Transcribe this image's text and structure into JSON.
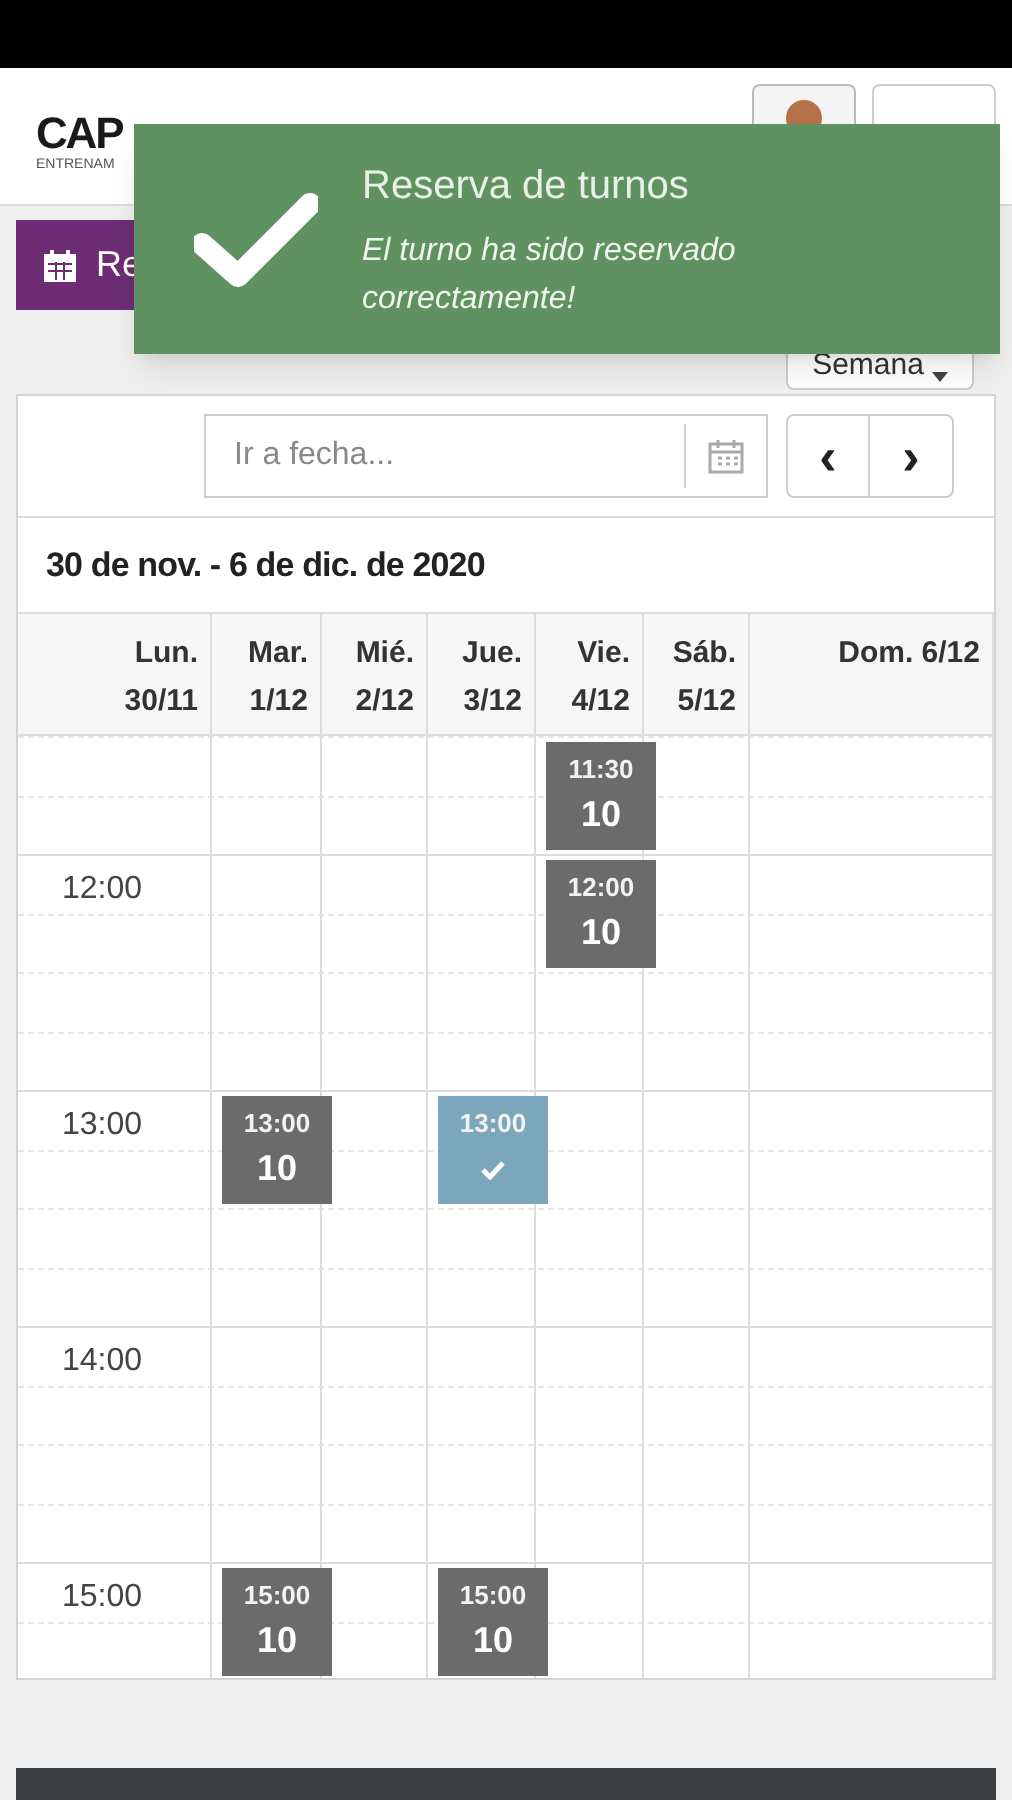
{
  "header": {
    "logo": "CAP",
    "tagline": "ENTRENAM"
  },
  "toolbar": {
    "primary_button": "Re",
    "view_dropdown": "Semana"
  },
  "toast": {
    "title": "Reserva de turnos",
    "message": "El turno ha sido reservado correctamente!"
  },
  "calendar": {
    "date_field": {
      "placeholder": "Ir a fecha..."
    },
    "nav_buttons": [
      "‹",
      "›"
    ],
    "title": "30 de nov. - 6 de dic. de 2020",
    "days": [
      {
        "label": "Lun.",
        "date": "30/11"
      },
      {
        "label": "Mar.",
        "date": "1/12",
        "events": [
          {
            "start": "13:00",
            "spots": "10",
            "booked": false
          },
          {
            "start": "15:00",
            "spots": "10",
            "booked": false
          }
        ]
      },
      {
        "label": "Mié.",
        "date": "2/12"
      },
      {
        "label": "Jue.",
        "date": "3/12",
        "events": [
          {
            "start": "13:00",
            "booked": true
          },
          {
            "start": "15:00",
            "spots": "10",
            "booked": false
          }
        ]
      },
      {
        "label": "Vie.",
        "date": "4/12",
        "events": [
          {
            "start": "11:30",
            "spots": "10",
            "booked": false
          },
          {
            "start": "12:00",
            "spots": "10",
            "booked": false
          }
        ]
      },
      {
        "label": "Sáb.",
        "date": "5/12"
      },
      {
        "label": "Dom. 6/12"
      }
    ],
    "time_labels": [
      "12:00",
      "13:00",
      "14:00",
      "15:00"
    ]
  }
}
